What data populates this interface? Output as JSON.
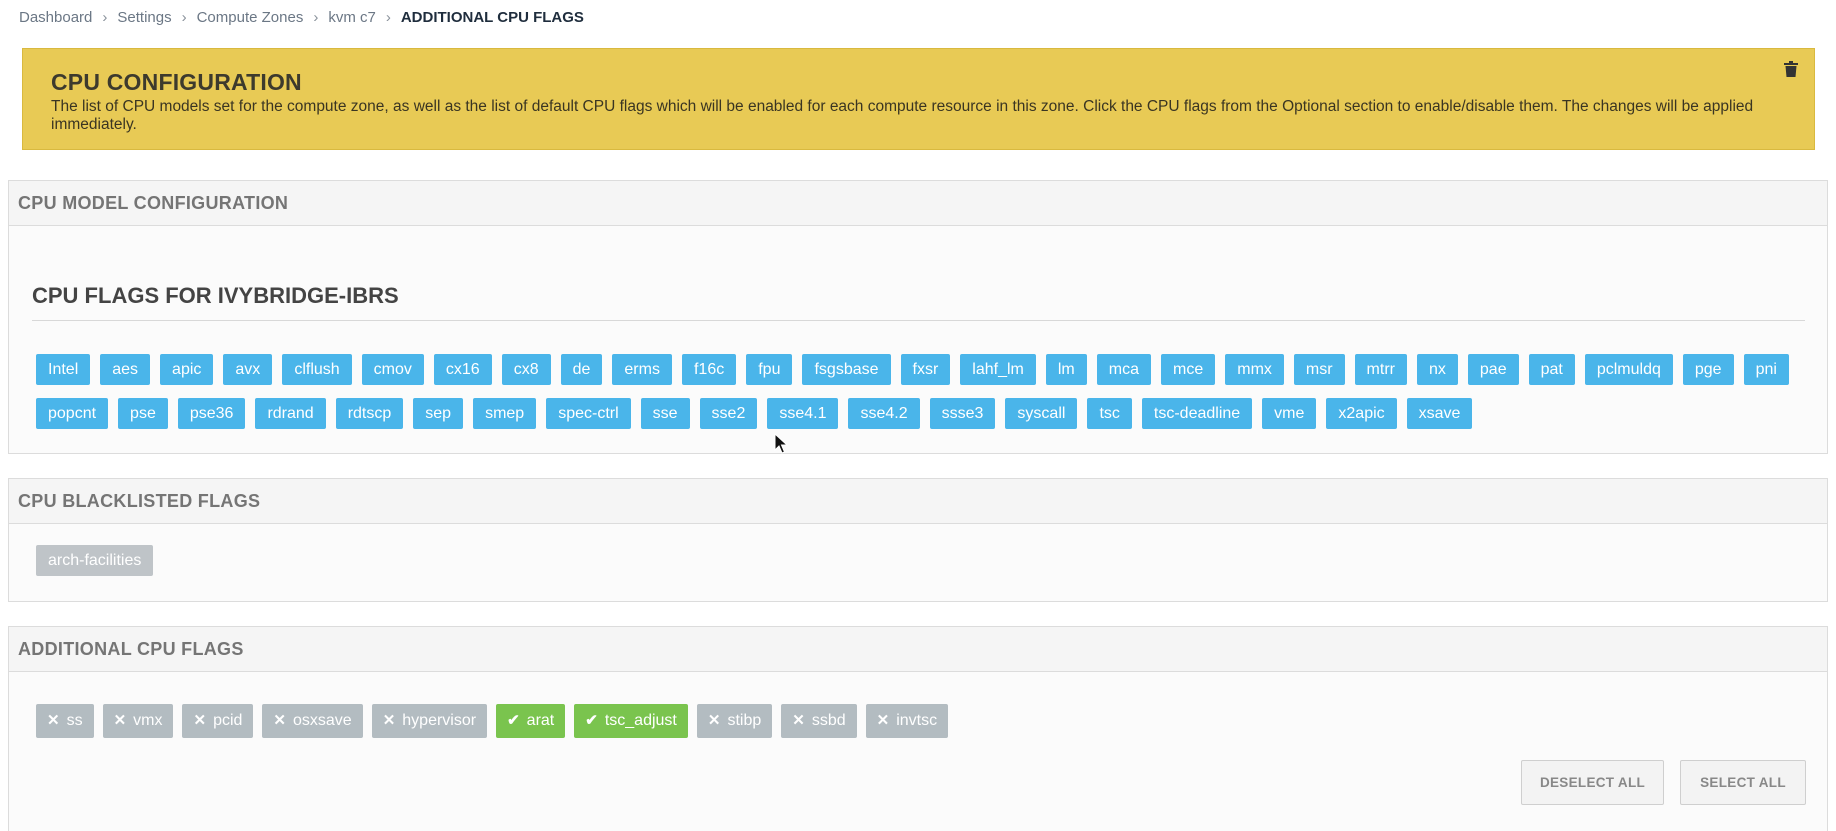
{
  "breadcrumb": {
    "items": [
      "Dashboard",
      "Settings",
      "Compute Zones",
      "kvm c7"
    ],
    "current": "ADDITIONAL CPU FLAGS"
  },
  "alert": {
    "title": "CPU CONFIGURATION",
    "description": "The list of CPU models set for the compute zone, as well as the list of default CPU flags which will be enabled for each compute resource in this zone.  Click the CPU flags from the Optional section to enable/disable them. The changes will be applied immediately.",
    "icon": "trash-icon",
    "color": "#e8ca55"
  },
  "model_panel": {
    "title": "CPU MODEL CONFIGURATION",
    "subtitle": "CPU FLAGS FOR IVYBRIDGE-IBRS",
    "flags": [
      "Intel",
      "aes",
      "apic",
      "avx",
      "clflush",
      "cmov",
      "cx16",
      "cx8",
      "de",
      "erms",
      "f16c",
      "fpu",
      "fsgsbase",
      "fxsr",
      "lahf_lm",
      "lm",
      "mca",
      "mce",
      "mmx",
      "msr",
      "mtrr",
      "nx",
      "pae",
      "pat",
      "pclmuldq",
      "pge",
      "pni",
      "popcnt",
      "pse",
      "pse36",
      "rdrand",
      "rdtscp",
      "sep",
      "smep",
      "spec-ctrl",
      "sse",
      "sse2",
      "sse4.1",
      "sse4.2",
      "ssse3",
      "syscall",
      "tsc",
      "tsc-deadline",
      "vme",
      "x2apic",
      "xsave"
    ],
    "tag_color": "#4ab5ea"
  },
  "blacklist_panel": {
    "title": "CPU BLACKLISTED FLAGS",
    "flags": [
      "arch-facilities"
    ],
    "tag_color": "#bfc4c8"
  },
  "additional_panel": {
    "title": "ADDITIONAL CPU FLAGS",
    "flags": [
      {
        "label": "ss",
        "enabled": false
      },
      {
        "label": "vmx",
        "enabled": false
      },
      {
        "label": "pcid",
        "enabled": false
      },
      {
        "label": "osxsave",
        "enabled": false
      },
      {
        "label": "hypervisor",
        "enabled": false
      },
      {
        "label": "arat",
        "enabled": true
      },
      {
        "label": "tsc_adjust",
        "enabled": true
      },
      {
        "label": "stibp",
        "enabled": false
      },
      {
        "label": "ssbd",
        "enabled": false
      },
      {
        "label": "invtsc",
        "enabled": false
      }
    ],
    "enabled_color": "#7ac44e",
    "disabled_color": "#b3bcc1",
    "deselect_label": "DESELECT ALL",
    "select_label": "SELECT ALL"
  }
}
